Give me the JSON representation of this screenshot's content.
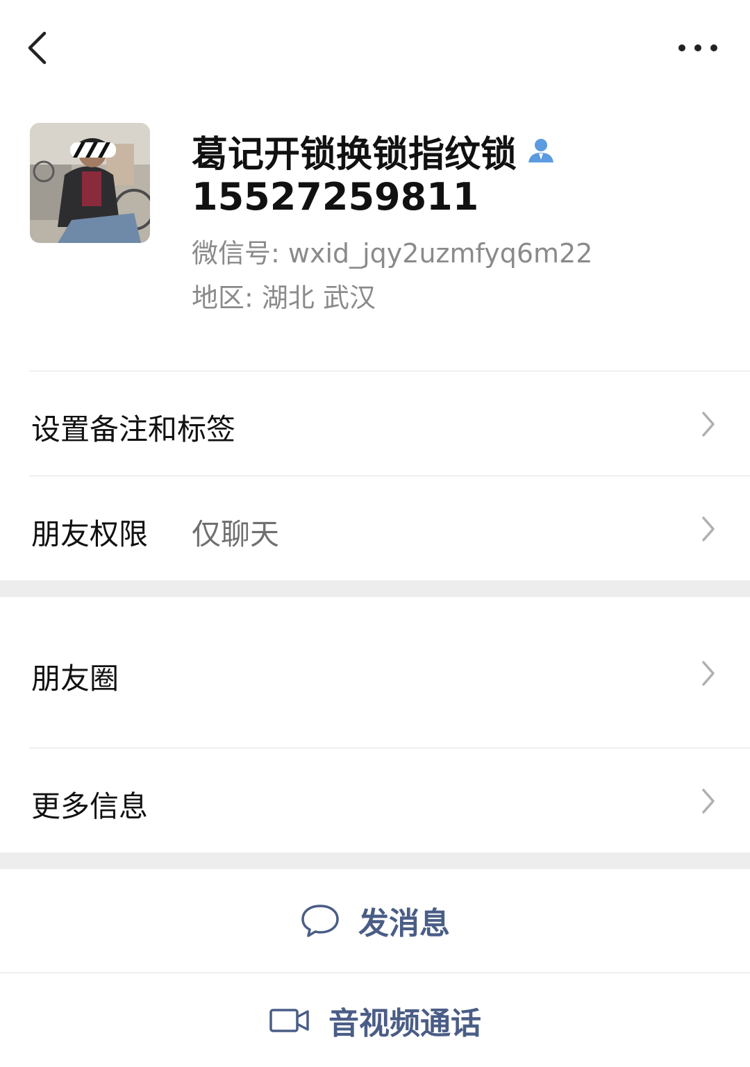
{
  "header": {
    "back_icon": "chevron-left-icon",
    "more_icon": "ellipsis-icon"
  },
  "profile": {
    "name": "葛记开锁换锁指纹锁",
    "verify_icon": "person-icon",
    "verify_color": "#5b9be0",
    "phone": "15527259811",
    "wechat_id": "微信号: wxid_jqy2uzmfyq6m22",
    "region": "地区: 湖北  武汉"
  },
  "settings": {
    "remark_label": "设置备注和标签",
    "permission_label": "朋友权限",
    "permission_value": "仅聊天",
    "moments_label": "朋友圈",
    "more_info_label": "更多信息"
  },
  "actions": {
    "message_label": "发消息",
    "message_icon": "chat-bubble-icon",
    "call_label": "音视频通话",
    "call_icon": "video-camera-icon",
    "accent_color": "#4a5d86"
  }
}
